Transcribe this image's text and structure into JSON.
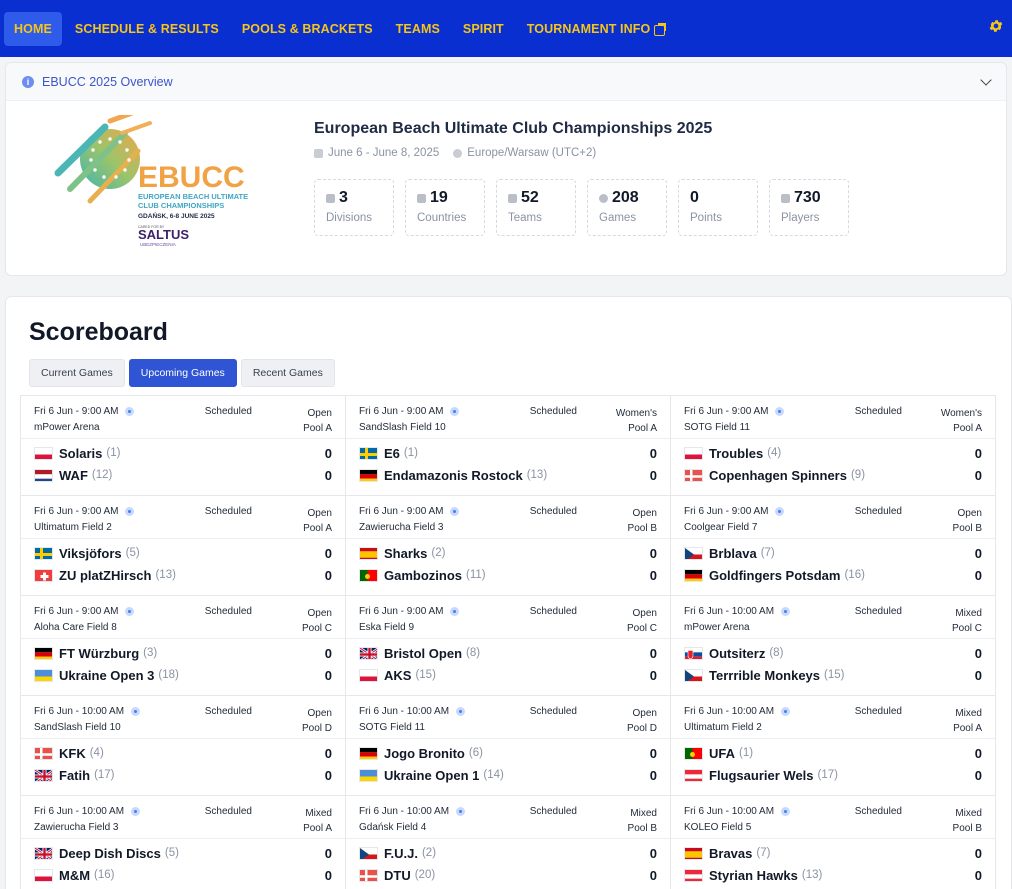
{
  "nav": {
    "items": [
      {
        "label": "HOME",
        "active": true
      },
      {
        "label": "SCHEDULE & RESULTS",
        "active": false
      },
      {
        "label": "POOLS & BRACKETS",
        "active": false
      },
      {
        "label": "TEAMS",
        "active": false
      },
      {
        "label": "SPIRIT",
        "active": false
      },
      {
        "label": "TOURNAMENT INFO",
        "active": false
      }
    ],
    "settings_icon": "gear-icon"
  },
  "overview": {
    "header": "EBUCC 2025 Overview",
    "logo": {
      "brand": "EBUCC",
      "line1": "EUROPEAN BEACH ULTIMATE",
      "line2": "CLUB CHAMPIONSHIPS",
      "line3": "GDAŃSK, 6-8 JUNE 2025",
      "sponsor_caption": "CARED FOR BY",
      "sponsor": "SALTUS",
      "sponsor_sub": "UBEZPIECZENIA"
    },
    "title": "European Beach Ultimate Club Championships 2025",
    "dates": "June 6 - June 8, 2025",
    "timezone": "Europe/Warsaw (UTC+2)",
    "stats": [
      {
        "value": "3",
        "label": "Divisions",
        "icon": "trophy-icon"
      },
      {
        "value": "19",
        "label": "Countries",
        "icon": "flag-icon"
      },
      {
        "value": "52",
        "label": "Teams",
        "icon": "shirt-icon"
      },
      {
        "value": "208",
        "label": "Games",
        "icon": "disc-icon"
      },
      {
        "value": "0",
        "label": "Points",
        "icon": ""
      },
      {
        "value": "730",
        "label": "Players",
        "icon": "players-icon"
      }
    ]
  },
  "scoreboard": {
    "title": "Scoreboard",
    "tabs": [
      {
        "label": "Current Games",
        "active": false
      },
      {
        "label": "Upcoming Games",
        "active": true
      },
      {
        "label": "Recent Games",
        "active": false
      }
    ],
    "games": [
      {
        "time": "Fri 6 Jun - 9:00 AM",
        "status": "Scheduled",
        "division": "Open",
        "pool": "Pool A",
        "field": "mPower Arena",
        "team1": {
          "name": "Solaris",
          "seed": "(1)",
          "score": "0",
          "flag": "PL"
        },
        "team2": {
          "name": "WAF",
          "seed": "(12)",
          "score": "0",
          "flag": "NL"
        }
      },
      {
        "time": "Fri 6 Jun - 9:00 AM",
        "status": "Scheduled",
        "division": "Women's",
        "pool": "Pool A",
        "field": "SandSlash Field 10",
        "team1": {
          "name": "E6",
          "seed": "(1)",
          "score": "0",
          "flag": "SE"
        },
        "team2": {
          "name": "Endamazonis Rostock",
          "seed": "(13)",
          "score": "0",
          "flag": "DE"
        }
      },
      {
        "time": "Fri 6 Jun - 9:00 AM",
        "status": "Scheduled",
        "division": "Women's",
        "pool": "Pool A",
        "field": "SOTG Field 11",
        "team1": {
          "name": "Troubles",
          "seed": "(4)",
          "score": "0",
          "flag": "PL"
        },
        "team2": {
          "name": "Copenhagen Spinners",
          "seed": "(9)",
          "score": "0",
          "flag": "DK"
        }
      },
      {
        "time": "Fri 6 Jun - 9:00 AM",
        "status": "Scheduled",
        "division": "Open",
        "pool": "Pool A",
        "field": "Ultimatum Field 2",
        "team1": {
          "name": "Viksjöfors",
          "seed": "(5)",
          "score": "0",
          "flag": "SE"
        },
        "team2": {
          "name": "ZU platZHirsch",
          "seed": "(13)",
          "score": "0",
          "flag": "CH"
        }
      },
      {
        "time": "Fri 6 Jun - 9:00 AM",
        "status": "Scheduled",
        "division": "Open",
        "pool": "Pool B",
        "field": "Zawierucha Field 3",
        "team1": {
          "name": "Sharks",
          "seed": "(2)",
          "score": "0",
          "flag": "ES"
        },
        "team2": {
          "name": "Gambozinos",
          "seed": "(11)",
          "score": "0",
          "flag": "PT"
        }
      },
      {
        "time": "Fri 6 Jun - 9:00 AM",
        "status": "Scheduled",
        "division": "Open",
        "pool": "Pool B",
        "field": "Coolgear Field 7",
        "team1": {
          "name": "Brblava",
          "seed": "(7)",
          "score": "0",
          "flag": "CZ"
        },
        "team2": {
          "name": "Goldfingers Potsdam",
          "seed": "(16)",
          "score": "0",
          "flag": "DE"
        }
      },
      {
        "time": "Fri 6 Jun - 9:00 AM",
        "status": "Scheduled",
        "division": "Open",
        "pool": "Pool C",
        "field": "Aloha Care Field 8",
        "team1": {
          "name": "FT Würzburg",
          "seed": "(3)",
          "score": "0",
          "flag": "DE"
        },
        "team2": {
          "name": "Ukraine Open 3",
          "seed": "(18)",
          "score": "0",
          "flag": "UA"
        }
      },
      {
        "time": "Fri 6 Jun - 9:00 AM",
        "status": "Scheduled",
        "division": "Open",
        "pool": "Pool C",
        "field": "Eska Field 9",
        "team1": {
          "name": "Bristol Open",
          "seed": "(8)",
          "score": "0",
          "flag": "GB"
        },
        "team2": {
          "name": "AKS",
          "seed": "(15)",
          "score": "0",
          "flag": "PL"
        }
      },
      {
        "time": "Fri 6 Jun - 10:00 AM",
        "status": "Scheduled",
        "division": "Mixed",
        "pool": "Pool C",
        "field": "mPower Arena",
        "team1": {
          "name": "Outsiterz",
          "seed": "(8)",
          "score": "0",
          "flag": "SK"
        },
        "team2": {
          "name": "Terrrible Monkeys",
          "seed": "(15)",
          "score": "0",
          "flag": "CZ"
        }
      },
      {
        "time": "Fri 6 Jun - 10:00 AM",
        "status": "Scheduled",
        "division": "Open",
        "pool": "Pool D",
        "field": "SandSlash Field 10",
        "team1": {
          "name": "KFK",
          "seed": "(4)",
          "score": "0",
          "flag": "DK"
        },
        "team2": {
          "name": "Fatih",
          "seed": "(17)",
          "score": "0",
          "flag": "GB"
        }
      },
      {
        "time": "Fri 6 Jun - 10:00 AM",
        "status": "Scheduled",
        "division": "Open",
        "pool": "Pool D",
        "field": "SOTG Field 11",
        "team1": {
          "name": "Jogo Bronito",
          "seed": "(6)",
          "score": "0",
          "flag": "DE"
        },
        "team2": {
          "name": "Ukraine Open 1",
          "seed": "(14)",
          "score": "0",
          "flag": "UA"
        }
      },
      {
        "time": "Fri 6 Jun - 10:00 AM",
        "status": "Scheduled",
        "division": "Mixed",
        "pool": "Pool A",
        "field": "Ultimatum Field 2",
        "team1": {
          "name": "UFA",
          "seed": "(1)",
          "score": "0",
          "flag": "PT"
        },
        "team2": {
          "name": "Flugsaurier Wels",
          "seed": "(17)",
          "score": "0",
          "flag": "AT"
        }
      },
      {
        "time": "Fri 6 Jun - 10:00 AM",
        "status": "Scheduled",
        "division": "Mixed",
        "pool": "Pool A",
        "field": "Zawierucha Field 3",
        "team1": {
          "name": "Deep Dish Discs",
          "seed": "(5)",
          "score": "0",
          "flag": "GB"
        },
        "team2": {
          "name": "M&M",
          "seed": "(16)",
          "score": "0",
          "flag": "PL"
        }
      },
      {
        "time": "Fri 6 Jun - 10:00 AM",
        "status": "Scheduled",
        "division": "Mixed",
        "pool": "Pool B",
        "field": "Gdańsk Field 4",
        "team1": {
          "name": "F.U.J.",
          "seed": "(2)",
          "score": "0",
          "flag": "CZ"
        },
        "team2": {
          "name": "DTU",
          "seed": "(20)",
          "score": "0",
          "flag": "DK"
        }
      },
      {
        "time": "Fri 6 Jun - 10:00 AM",
        "status": "Scheduled",
        "division": "Mixed",
        "pool": "Pool B",
        "field": "KOLEO Field 5",
        "team1": {
          "name": "Bravas",
          "seed": "(7)",
          "score": "0",
          "flag": "ES"
        },
        "team2": {
          "name": "Styrian Hawks",
          "seed": "(13)",
          "score": "0",
          "flag": "AT"
        }
      }
    ]
  }
}
